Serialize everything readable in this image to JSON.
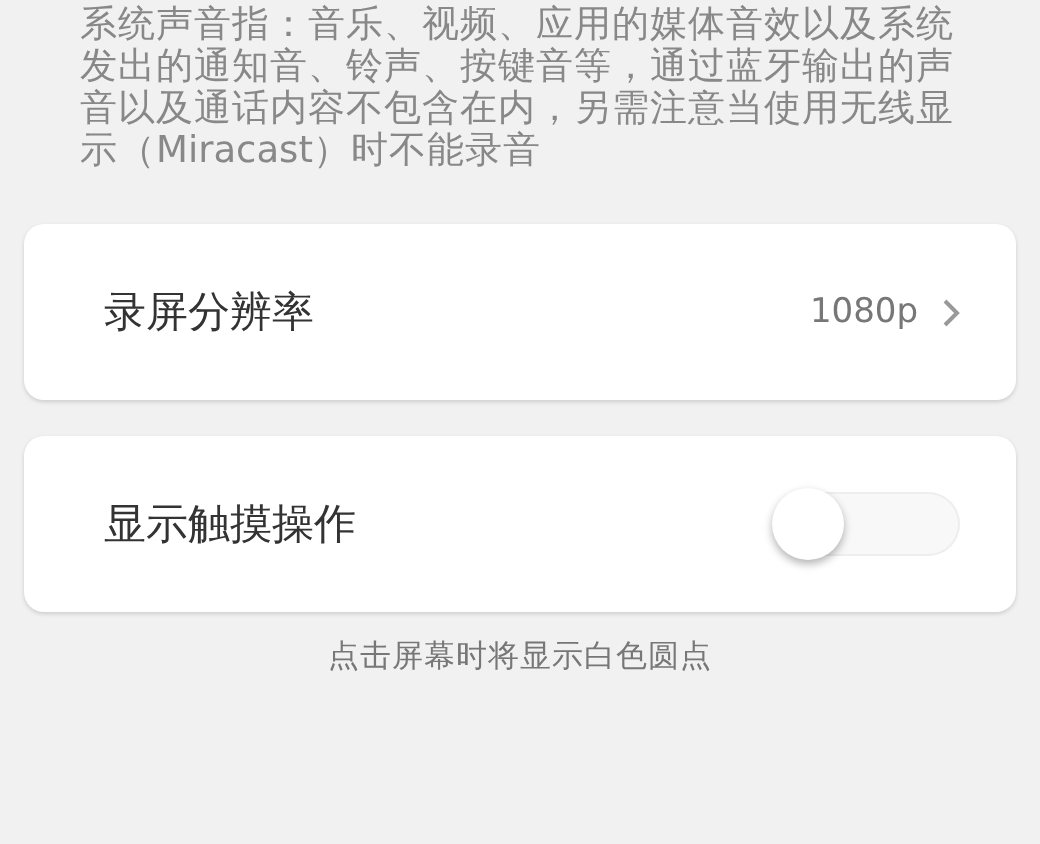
{
  "description": "系统声音指：音乐、视频、应用的媒体音效以及系统发出的通知音、铃声、按键音等，通过蓝牙输出的声音以及通话内容不包含在内，另需注意当使用无线显示（Miracast）时不能录音",
  "settings": [
    {
      "kind": "link",
      "label": "录屏分辨率",
      "value": "1080p"
    },
    {
      "kind": "toggle",
      "label": "显示触摸操作",
      "on": false
    }
  ],
  "hint": "点击屏幕时将显示白色圆点"
}
